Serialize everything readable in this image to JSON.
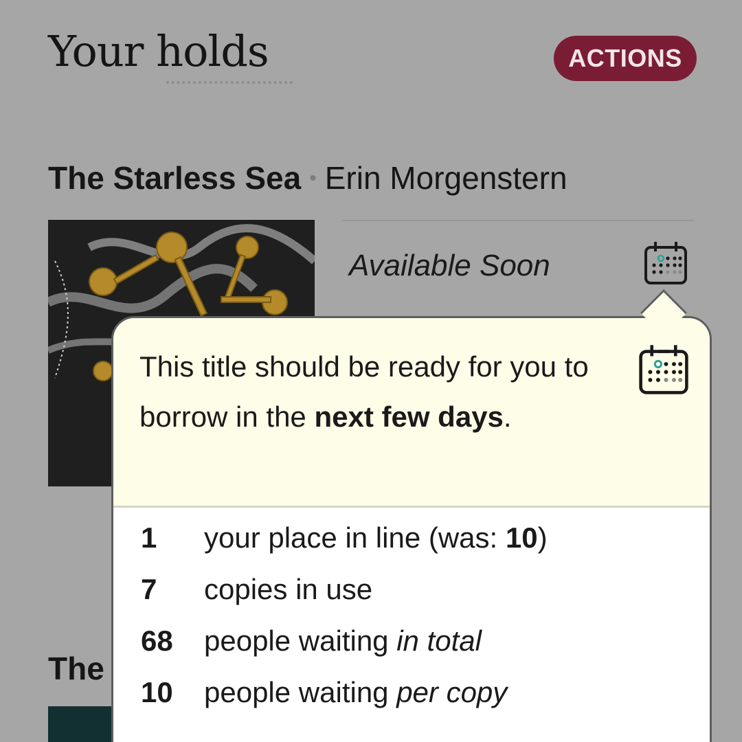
{
  "header": {
    "title": "Your holds",
    "actions_label": "ACTIONS"
  },
  "hold": {
    "title": "The Starless Sea",
    "separator": "•",
    "author": "Erin Morgenstern",
    "status": "Available Soon",
    "status_icon": "calendar-icon"
  },
  "next_hold": {
    "title_partial": "The"
  },
  "popover": {
    "message_start": "This title should be ready for you to borrow in the ",
    "message_emphasis": "next few days",
    "message_end": ".",
    "icon": "calendar-icon",
    "stats": [
      {
        "value": "1",
        "label_start": "your place in line (was: ",
        "label_bold": "10",
        "label_end": ")"
      },
      {
        "value": "7",
        "label_start": "copies in use"
      },
      {
        "value": "68",
        "label_start": "people waiting ",
        "label_italic": "in total"
      },
      {
        "value": "10",
        "label_start": "people waiting ",
        "label_italic": "per copy"
      }
    ]
  },
  "colors": {
    "accent": "#7a1d34",
    "popover_highlight": "#fefde8",
    "background": "#a6a6a6"
  }
}
